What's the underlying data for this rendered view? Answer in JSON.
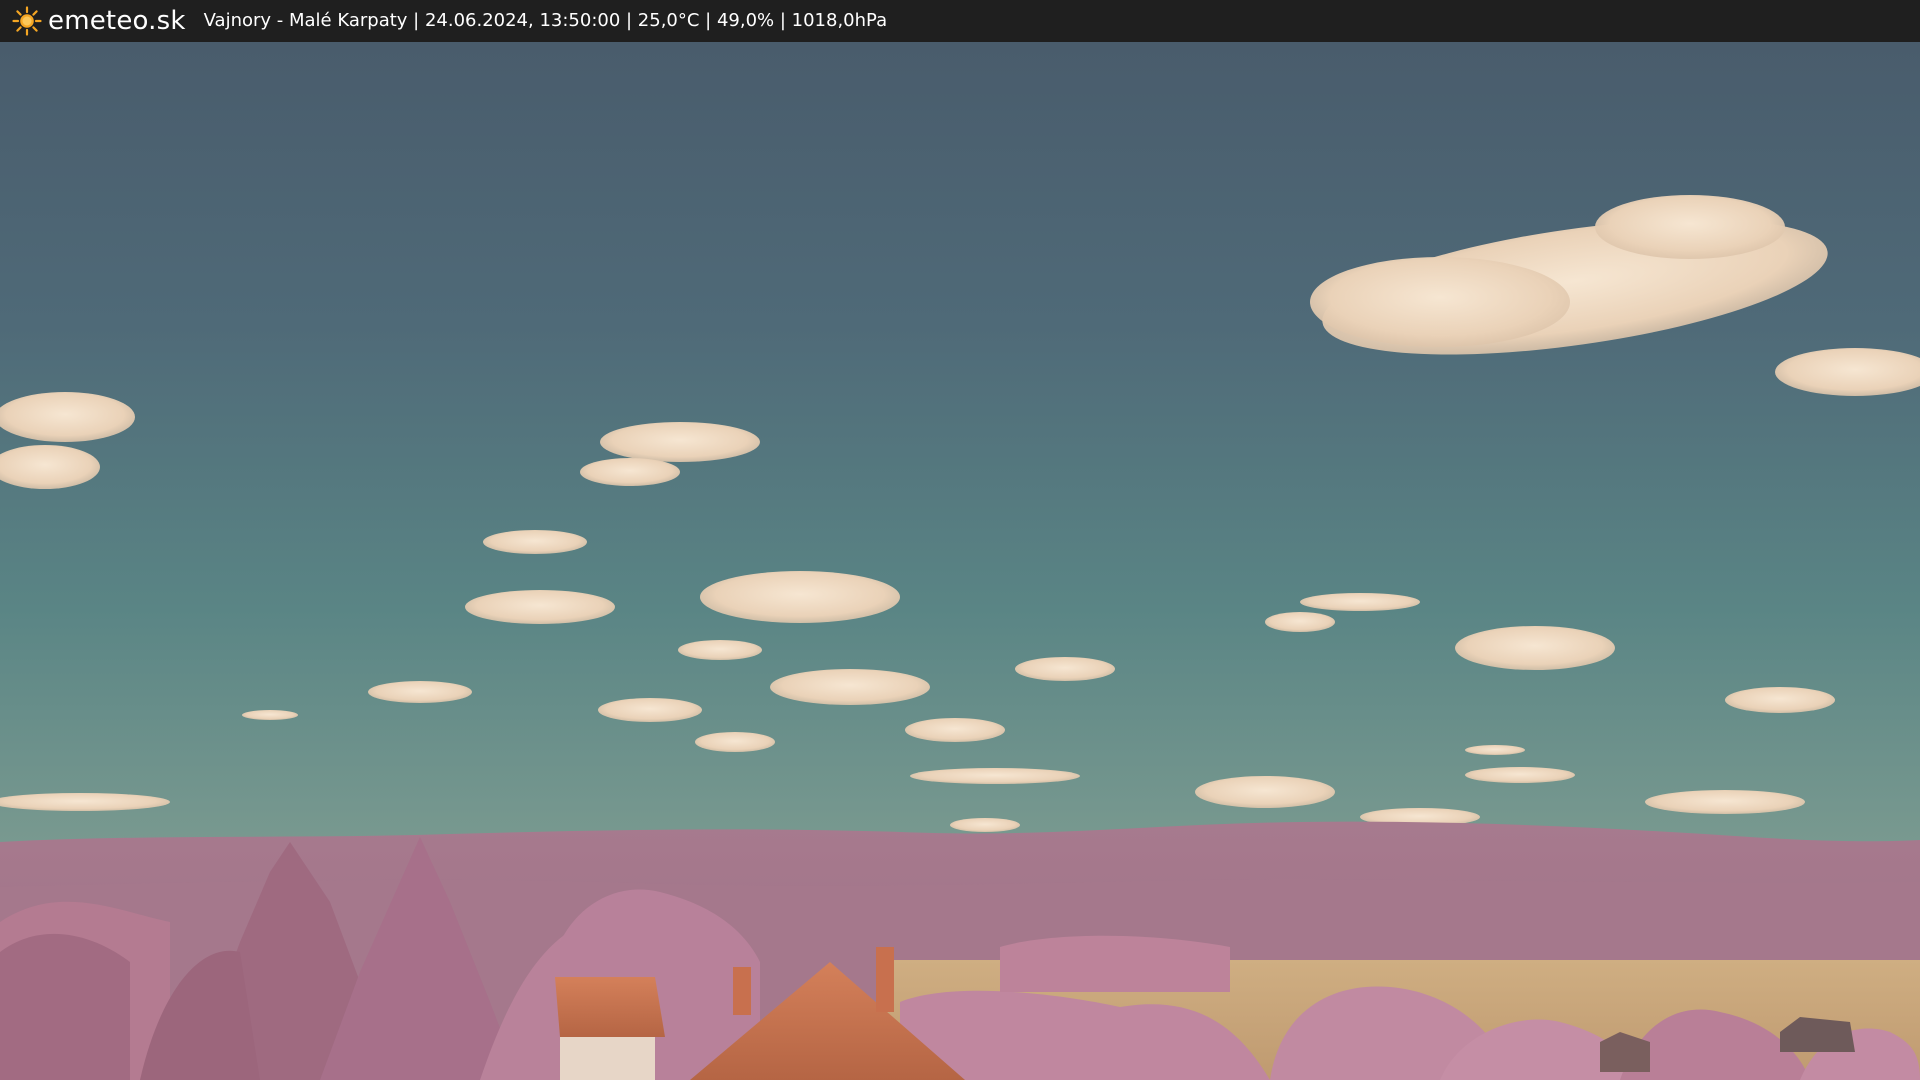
{
  "header": {
    "brand_name": "emeteo.sk",
    "caption": "Vajnory - Malé Karpaty | 24.06.2024, 13:50:00 | 25,0°C | 49,0% | 1018,0hPa",
    "logo_icon": "sun-icon",
    "bar_color": "#1f1f1f",
    "logo_color": "#f5a623"
  },
  "scene": {
    "sky_top_color": "#4a5f70",
    "sky_bottom_color": "#5e8f8c",
    "hills_color": "#a9798f",
    "trees_color": "#b77a90",
    "field_color": "#c9a77a",
    "roof_color": "#c8704e"
  }
}
